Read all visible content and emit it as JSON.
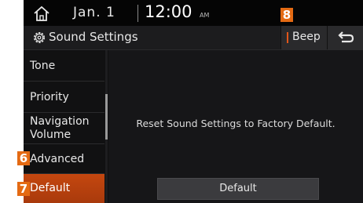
{
  "status_bar": {
    "home_icon": "home-icon",
    "date": "Jan. 1",
    "time": "12:00",
    "ampm": "AM"
  },
  "title_bar": {
    "icon": "gear-icon",
    "title": "Sound Settings",
    "beep_label": "Beep",
    "back_icon": "back-arrow-icon"
  },
  "menu": {
    "items": [
      {
        "label": "Tone"
      },
      {
        "label": "Priority"
      },
      {
        "label": "Navigation Volume"
      },
      {
        "label": "Advanced"
      },
      {
        "label": "Default"
      }
    ],
    "active_index": 4
  },
  "content": {
    "message": "Reset Sound Settings to Factory Default.",
    "button_label": "Default"
  },
  "callouts": {
    "advanced": "6",
    "default": "7",
    "beep": "8"
  },
  "colors": {
    "accent": "#e46a13",
    "active_item": "#b8420f",
    "background": "#0e0e0f"
  }
}
